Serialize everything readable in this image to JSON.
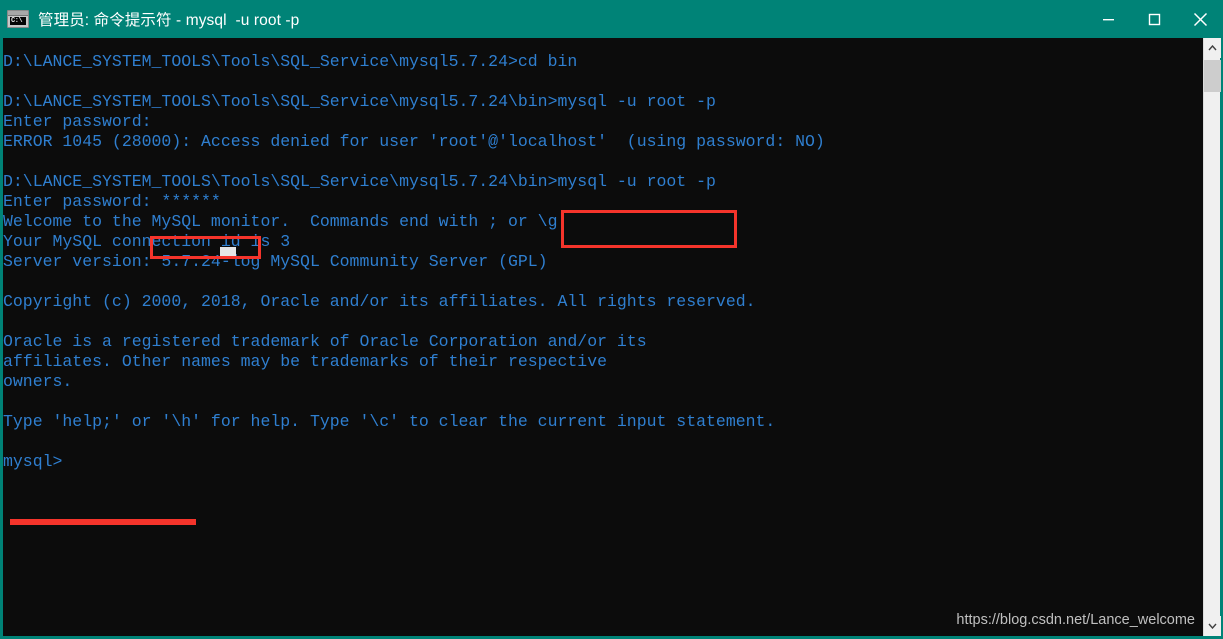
{
  "window": {
    "title": "管理员: 命令提示符 - mysql  -u root -p",
    "icon": "cmd-console-icon",
    "icon_glyph": "C:\\",
    "titlebar_color": "#008377",
    "controls": {
      "minimize_label": "Minimize",
      "maximize_label": "Maximize",
      "close_label": "Close"
    }
  },
  "terminal": {
    "background_color": "#0c0c0c",
    "text_color": "#2f7fd0",
    "lines": [
      "D:\\LANCE_SYSTEM_TOOLS\\Tools\\SQL_Service\\mysql5.7.24>cd bin",
      "",
      "D:\\LANCE_SYSTEM_TOOLS\\Tools\\SQL_Service\\mysql5.7.24\\bin>mysql -u root -p",
      "Enter password:",
      "ERROR 1045 (28000): Access denied for user 'root'@'localhost'  (using password: NO)",
      "",
      "D:\\LANCE_SYSTEM_TOOLS\\Tools\\SQL_Service\\mysql5.7.24\\bin>mysql -u root -p",
      "Enter password: ******",
      "Welcome to the MySQL monitor.  Commands end with ; or \\g.",
      "Your MySQL connection id is 3",
      "Server version: 5.7.24-log MySQL Community Server (GPL)",
      "",
      "Copyright (c) 2000, 2018, Oracle and/or its affiliates. All rights reserved.",
      "",
      "Oracle is a registered trademark of Oracle Corporation and/or its",
      "affiliates. Other names may be trademarks of their respective",
      "owners.",
      "",
      "Type 'help;' or '\\h' for help. Type '\\c' to clear the current input statement.",
      "",
      "mysql>"
    ]
  },
  "annotations": {
    "color": "#f5342b",
    "command_box_target": "mysql -u root -p",
    "password_box_target": "******",
    "prompt_underline_target": "mysql>"
  },
  "watermark": {
    "text": "https://blog.csdn.net/Lance_welcome"
  },
  "scrollbar": {
    "up_arrow": "▲",
    "down_arrow": "▼",
    "position": "top"
  }
}
